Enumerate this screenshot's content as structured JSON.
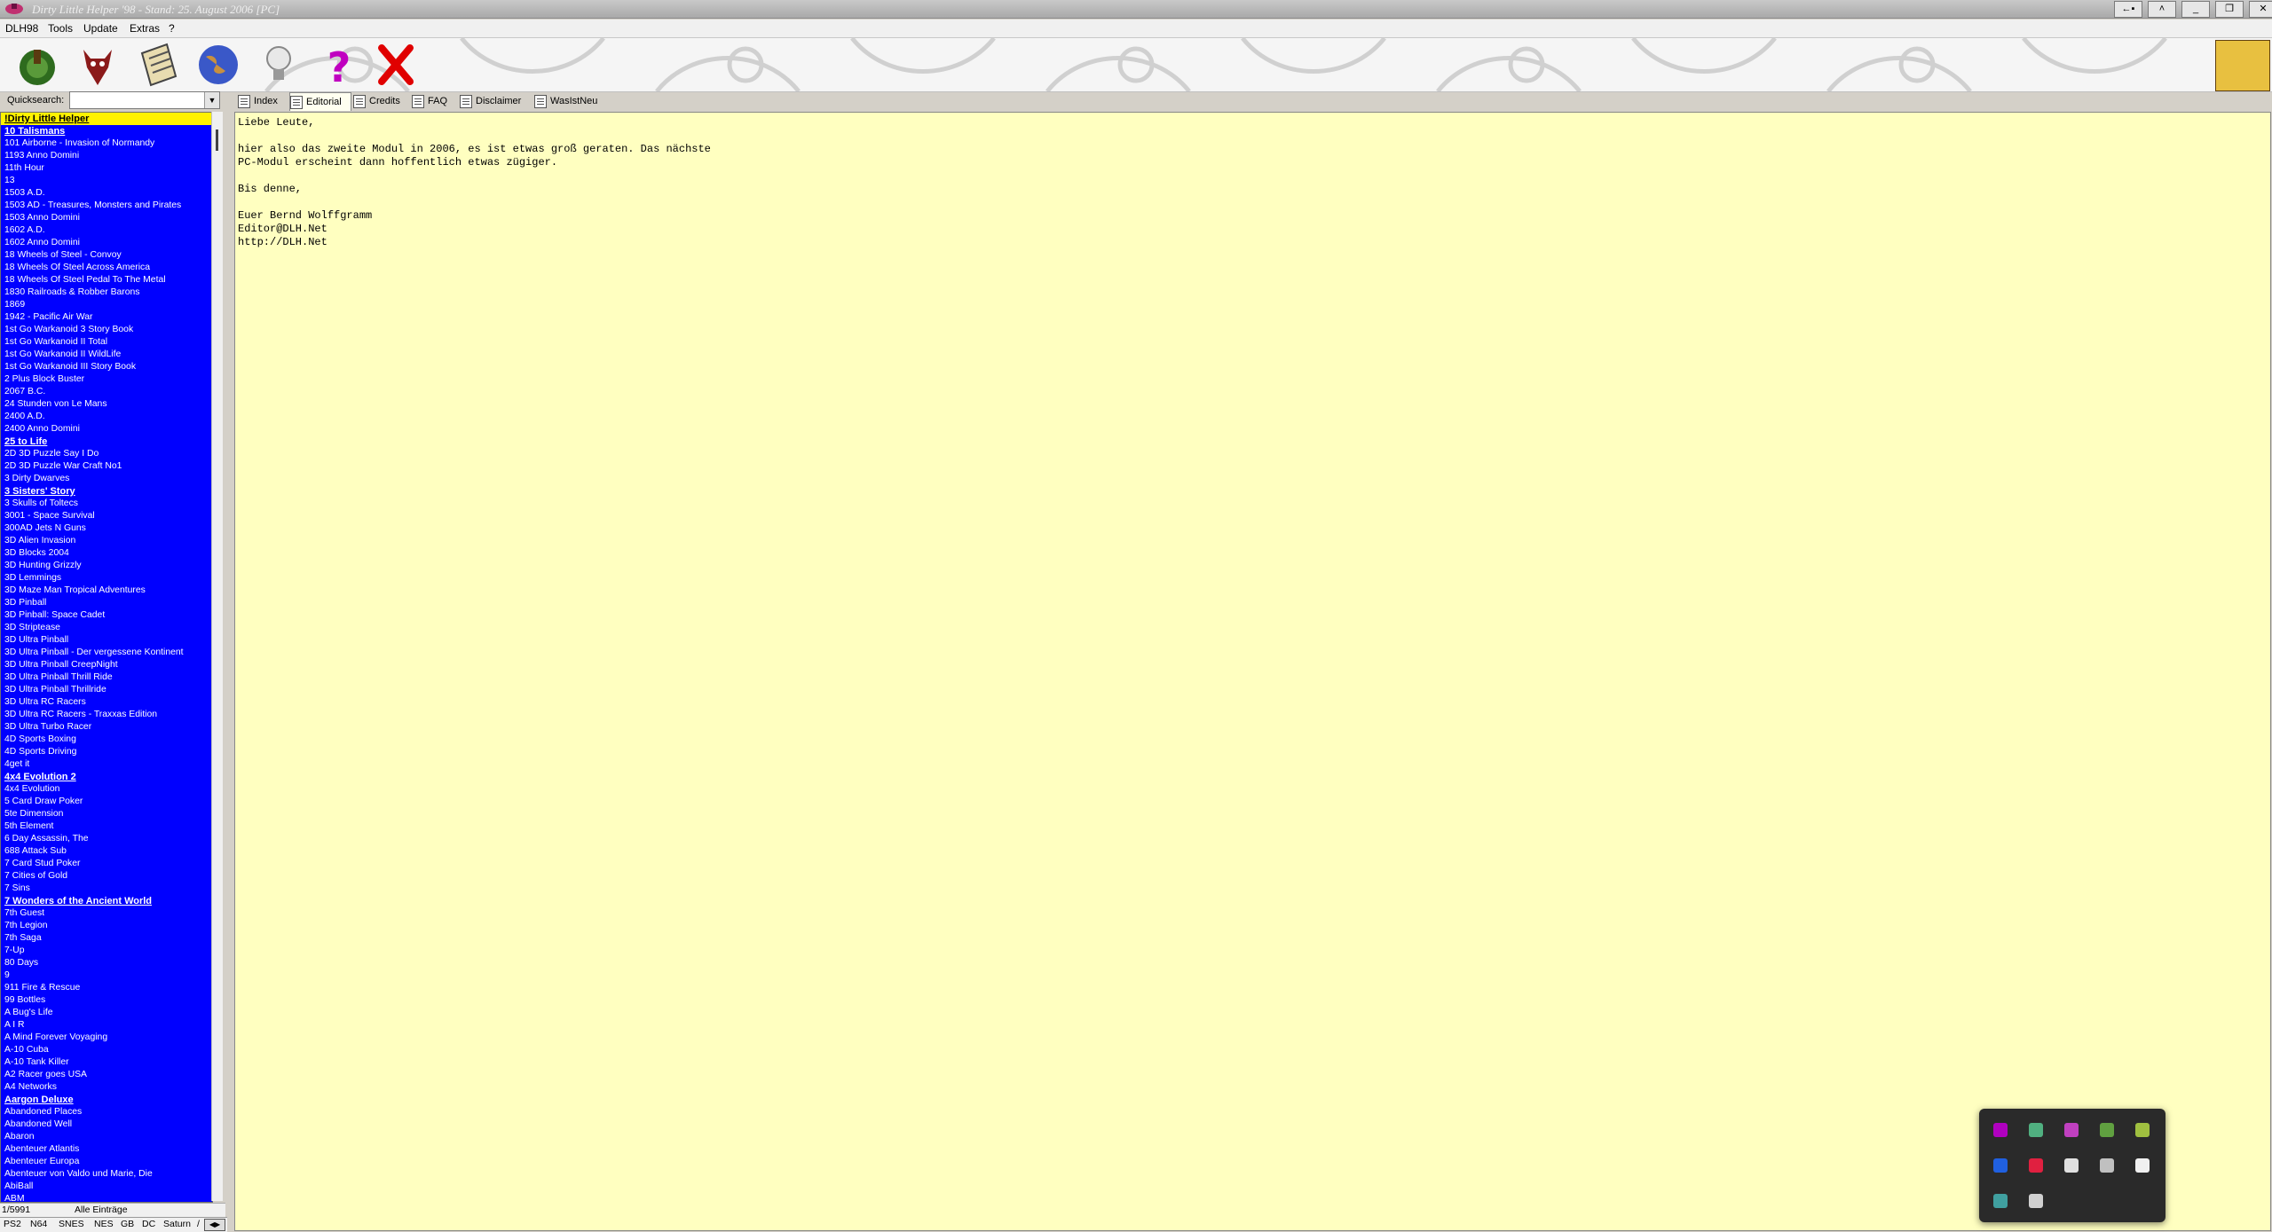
{
  "window": {
    "title": "Dirty Little Helper '98 - Stand: 25. August 2006 [PC]",
    "controls": [
      "←▪",
      "˄",
      "_",
      "❐",
      "✕"
    ]
  },
  "menu": [
    "DLH98",
    "Tools",
    "Update",
    "Extras",
    "?"
  ],
  "toolbar": {
    "buttons": [
      {
        "name": "tree-globe-icon",
        "color": "#2e6b1e"
      },
      {
        "name": "devil-icon",
        "color": "#8b1a1a"
      },
      {
        "name": "notepad-icon",
        "color": "#c8b070"
      },
      {
        "name": "globe-icon",
        "color": "#3a58c8"
      },
      {
        "name": "lightbulb-icon",
        "color": "#d8d8d8"
      },
      {
        "name": "help-icon",
        "color": "#c000c0"
      },
      {
        "name": "close-icon",
        "color": "#e00000"
      }
    ]
  },
  "quicksearch": {
    "label": "Quicksearch:",
    "value": ""
  },
  "game_list": [
    {
      "t": "!Dirty Little Helper",
      "bold": true,
      "selected": true
    },
    {
      "t": "10 Talismans",
      "bold": true
    },
    {
      "t": "101 Airborne - Invasion of Normandy"
    },
    {
      "t": "1193 Anno Domini"
    },
    {
      "t": "11th Hour"
    },
    {
      "t": "13"
    },
    {
      "t": "1503 A.D."
    },
    {
      "t": "1503 AD - Treasures, Monsters and Pirates"
    },
    {
      "t": "1503 Anno Domini"
    },
    {
      "t": "1602 A.D."
    },
    {
      "t": "1602 Anno Domini"
    },
    {
      "t": "18 Wheels of Steel - Convoy"
    },
    {
      "t": "18 Wheels Of Steel Across America"
    },
    {
      "t": "18 Wheels Of Steel Pedal To The Metal"
    },
    {
      "t": "1830 Railroads & Robber Barons"
    },
    {
      "t": "1869"
    },
    {
      "t": "1942 - Pacific Air War"
    },
    {
      "t": "1st Go Warkanoid 3 Story Book"
    },
    {
      "t": "1st Go Warkanoid II Total"
    },
    {
      "t": "1st Go Warkanoid II WildLife"
    },
    {
      "t": "1st Go Warkanoid III Story Book"
    },
    {
      "t": "2 Plus Block Buster"
    },
    {
      "t": "2067 B.C."
    },
    {
      "t": "24 Stunden von Le Mans"
    },
    {
      "t": "2400 A.D."
    },
    {
      "t": "2400 Anno Domini"
    },
    {
      "t": "25 to Life",
      "bold": true
    },
    {
      "t": "2D 3D Puzzle Say I Do"
    },
    {
      "t": "2D 3D Puzzle War Craft No1"
    },
    {
      "t": "3 Dirty Dwarves"
    },
    {
      "t": "3 Sisters' Story",
      "bold": true
    },
    {
      "t": "3 Skulls of Toltecs"
    },
    {
      "t": "3001 - Space Survival"
    },
    {
      "t": "300AD Jets N Guns"
    },
    {
      "t": "3D Alien Invasion"
    },
    {
      "t": "3D Blocks 2004"
    },
    {
      "t": "3D Hunting Grizzly"
    },
    {
      "t": "3D Lemmings"
    },
    {
      "t": "3D Maze Man Tropical Adventures"
    },
    {
      "t": "3D Pinball"
    },
    {
      "t": "3D Pinball: Space Cadet"
    },
    {
      "t": "3D Striptease"
    },
    {
      "t": "3D Ultra Pinball"
    },
    {
      "t": "3D Ultra Pinball - Der vergessene Kontinent"
    },
    {
      "t": "3D Ultra Pinball CreepNight"
    },
    {
      "t": "3D Ultra Pinball Thrill Ride"
    },
    {
      "t": "3D Ultra Pinball Thrillride"
    },
    {
      "t": "3D Ultra RC Racers"
    },
    {
      "t": "3D Ultra RC Racers - Traxxas Edition"
    },
    {
      "t": "3D Ultra Turbo Racer"
    },
    {
      "t": "4D Sports Boxing"
    },
    {
      "t": "4D Sports Driving"
    },
    {
      "t": "4get it"
    },
    {
      "t": "4x4 Evolution 2",
      "bold": true
    },
    {
      "t": "4x4 Evolution"
    },
    {
      "t": "5 Card Draw Poker"
    },
    {
      "t": "5te Dimension"
    },
    {
      "t": "5th Element"
    },
    {
      "t": "6 Day Assassin, The"
    },
    {
      "t": "688 Attack Sub"
    },
    {
      "t": "7 Card Stud Poker"
    },
    {
      "t": "7 Cities of Gold"
    },
    {
      "t": "7 Sins"
    },
    {
      "t": "7 Wonders of the Ancient World",
      "bold": true
    },
    {
      "t": "7th Guest"
    },
    {
      "t": "7th Legion"
    },
    {
      "t": "7th Saga"
    },
    {
      "t": "7-Up"
    },
    {
      "t": "80 Days"
    },
    {
      "t": "9"
    },
    {
      "t": "911 Fire & Rescue"
    },
    {
      "t": "99 Bottles"
    },
    {
      "t": "A Bug's Life"
    },
    {
      "t": "A I R"
    },
    {
      "t": "A Mind Forever Voyaging"
    },
    {
      "t": "A-10 Cuba"
    },
    {
      "t": "A-10 Tank Killer"
    },
    {
      "t": "A2 Racer goes USA"
    },
    {
      "t": "A4 Networks"
    },
    {
      "t": "Aargon Deluxe",
      "bold": true
    },
    {
      "t": "Abandoned Places"
    },
    {
      "t": "Abandoned Well"
    },
    {
      "t": "Abaron"
    },
    {
      "t": "Abenteuer Atlantis"
    },
    {
      "t": "Abenteuer Europa"
    },
    {
      "t": "Abenteuer von Valdo und Marie, Die"
    },
    {
      "t": "AbiBall"
    },
    {
      "t": "ABM"
    }
  ],
  "list_status": {
    "count": "1/5991",
    "filter": "Alle Einträge"
  },
  "platforms": [
    "PS2",
    "N64",
    "SNES",
    "NES",
    "GB",
    "DC",
    "Saturn",
    "/"
  ],
  "tabs": [
    {
      "label": "Index",
      "active": false
    },
    {
      "label": "Editorial",
      "active": true
    },
    {
      "label": "Credits",
      "active": false
    },
    {
      "label": "FAQ",
      "active": false
    },
    {
      "label": "Disclaimer",
      "active": false
    },
    {
      "label": "WasIstNeu",
      "active": false
    }
  ],
  "content": {
    "text": "Liebe Leute,\n\nhier also das zweite Modul in 2006, es ist etwas groß geraten. Das nächste\nPC-Modul erscheint dann hoffentlich etwas zügiger.\n\nBis denne,\n\nEuer Bernd Wolffgramm\nEditor@DLH.Net\nhttp://DLH.Net"
  },
  "tray": {
    "icons": [
      {
        "name": "dlh-tray-icon",
        "color": "#b000c0"
      },
      {
        "name": "network-icon",
        "color": "#50b080"
      },
      {
        "name": "media-icon",
        "color": "#c040c0"
      },
      {
        "name": "folder-icon",
        "color": "#60a040"
      },
      {
        "name": "sync-icon",
        "color": "#a0c040"
      },
      {
        "name": "bluetooth-icon",
        "color": "#2060e0"
      },
      {
        "name": "app-red-icon",
        "color": "#e02040"
      },
      {
        "name": "gear-icon",
        "color": "#e0e0e0"
      },
      {
        "name": "steam-icon",
        "color": "#c0c0c0"
      },
      {
        "name": "ball-icon",
        "color": "#f0f0f0"
      },
      {
        "name": "shield-icon",
        "color": "#40a0a0"
      },
      {
        "name": "usb-icon",
        "color": "#d0d0d0"
      }
    ]
  }
}
